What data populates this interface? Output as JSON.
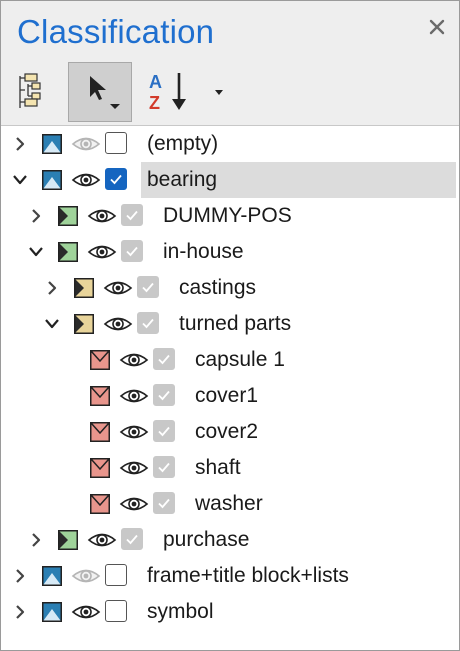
{
  "panel": {
    "title": "Classification",
    "close_icon": "close-icon"
  },
  "toolbar": {
    "tree_view_icon": "tree-view-icon",
    "select_tool_icon": "cursor-arrow-icon",
    "sort_icon": "sort-a-z-icon",
    "dropdown_icon": "chevron-down-icon"
  },
  "colors": {
    "title": "#1f6fcf",
    "selected_row": "#dcdcdc",
    "checkbox_checked": "#1565c0",
    "checkbox_inherited": "#c8c8c8",
    "icon_blue": "#2b7fb3",
    "icon_green": "#9fd39a",
    "icon_yellow": "#e8d49a",
    "icon_red": "#e8958c"
  },
  "tree": {
    "items": [
      {
        "label": "(empty)",
        "expanded": false,
        "icon": "layer-blue-icon",
        "visible": false,
        "check": "unchecked",
        "selected": false
      },
      {
        "label": "bearing",
        "expanded": true,
        "icon": "layer-blue-icon",
        "visible": true,
        "check": "checked",
        "selected": true
      },
      {
        "label": "DUMMY-POS",
        "expanded": false,
        "icon": "layer-green-icon",
        "visible": true,
        "check": "inherited",
        "selected": false
      },
      {
        "label": "in-house",
        "expanded": true,
        "icon": "layer-green-icon",
        "visible": true,
        "check": "inherited",
        "selected": false
      },
      {
        "label": "castings",
        "expanded": false,
        "icon": "layer-yellow-icon",
        "visible": true,
        "check": "inherited",
        "selected": false
      },
      {
        "label": "turned parts",
        "expanded": true,
        "icon": "layer-yellow-icon",
        "visible": true,
        "check": "inherited",
        "selected": false
      },
      {
        "label": "capsule 1",
        "icon": "layer-red-icon",
        "visible": true,
        "check": "inherited",
        "selected": false
      },
      {
        "label": "cover1",
        "icon": "layer-red-icon",
        "visible": true,
        "check": "inherited",
        "selected": false
      },
      {
        "label": "cover2",
        "icon": "layer-red-icon",
        "visible": true,
        "check": "inherited",
        "selected": false
      },
      {
        "label": "shaft",
        "icon": "layer-red-icon",
        "visible": true,
        "check": "inherited",
        "selected": false
      },
      {
        "label": "washer",
        "icon": "layer-red-icon",
        "visible": true,
        "check": "inherited",
        "selected": false
      },
      {
        "label": "purchase",
        "expanded": false,
        "icon": "layer-green-icon",
        "visible": true,
        "check": "inherited",
        "selected": false
      },
      {
        "label": "frame+title block+lists",
        "expanded": false,
        "icon": "layer-blue-icon",
        "visible": false,
        "check": "unchecked",
        "selected": false
      },
      {
        "label": "symbol",
        "expanded": false,
        "icon": "layer-blue-icon",
        "visible": true,
        "check": "unchecked",
        "selected": false
      }
    ]
  }
}
